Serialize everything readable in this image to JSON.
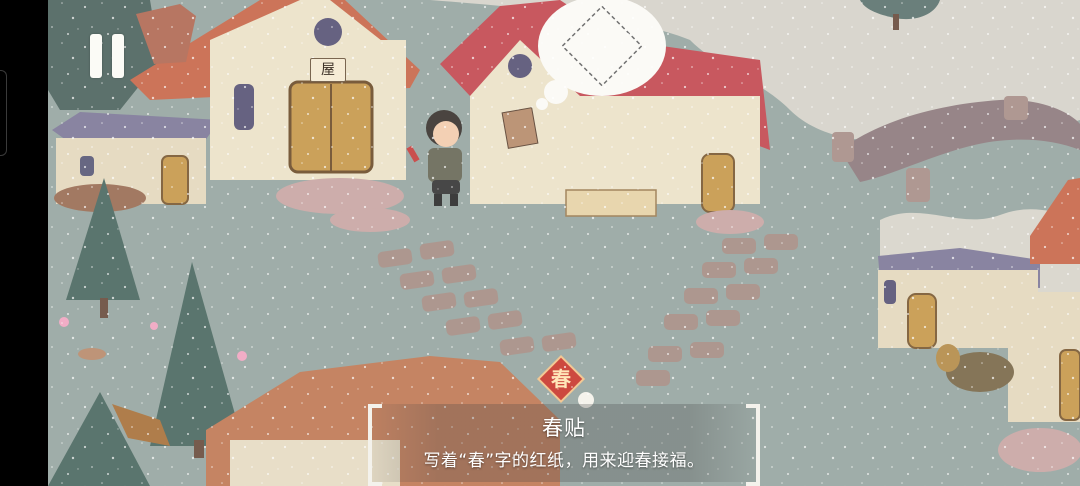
{
  "game": {
    "house_sign": "屋",
    "collected_item_icon_glyph": "春"
  },
  "hud": {
    "pause_icon": "pause-icon"
  },
  "item_tooltip": {
    "name": "春贴",
    "description": "写着“春”字的红纸，用来迎春接福。"
  },
  "colors": {
    "grass": "#97a7a2",
    "path_stone": "#a68f86",
    "roof_red": "#c44a52",
    "roof_orange": "#c8694b",
    "roof_purple": "#7f7a99",
    "wall_cream": "#e6dcc4",
    "door_wood": "#c79a4c",
    "water_snow": "#d9d6cc"
  }
}
